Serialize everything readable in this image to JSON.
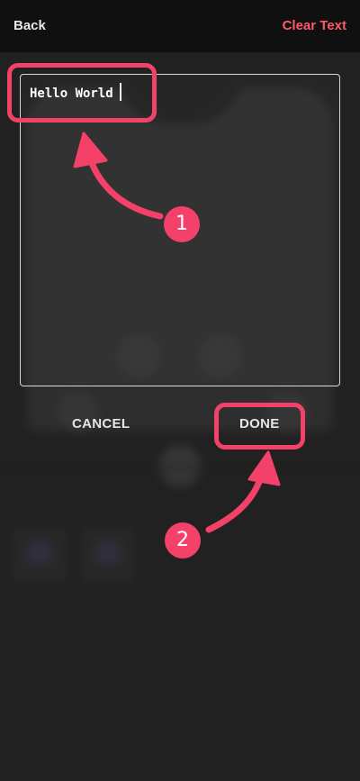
{
  "header": {
    "back_label": "Back",
    "clear_label": "Clear Text"
  },
  "editor": {
    "text_value": "Hello World"
  },
  "actions": {
    "cancel_label": "CANCEL",
    "done_label": "DONE"
  },
  "annotations": {
    "step1": "1",
    "step2": "2",
    "highlight_color": "#f3416a"
  },
  "colors": {
    "accent_red": "#ff5a64",
    "topbar_bg": "#101010",
    "page_bg": "#2b2b2b"
  }
}
